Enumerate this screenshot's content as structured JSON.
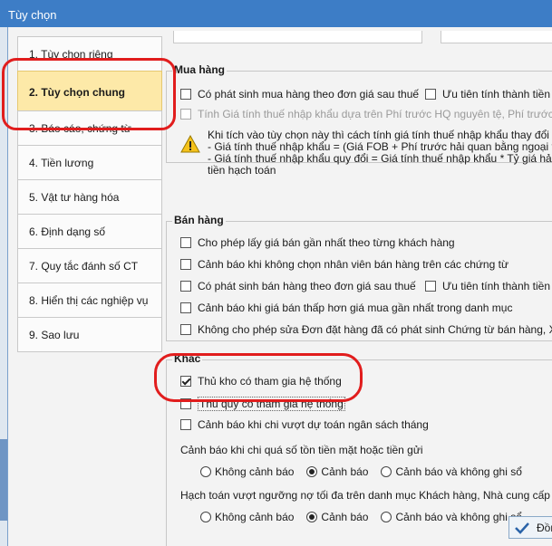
{
  "window": {
    "title": "Tùy chọn"
  },
  "nav": {
    "items": [
      {
        "label": "1. Tùy chọn riêng",
        "active": false
      },
      {
        "label": "2. Tùy chọn chung",
        "active": true
      },
      {
        "label": "3. Báo cáo, chứng từ",
        "active": false
      },
      {
        "label": "4. Tiền lương",
        "active": false
      },
      {
        "label": "5. Vật tư hàng hóa",
        "active": false
      },
      {
        "label": "6. Định dạng số",
        "active": false
      },
      {
        "label": "7. Quy tắc đánh số CT",
        "active": false
      },
      {
        "label": "8. Hiển thị các nghiệp vụ",
        "active": false
      },
      {
        "label": "9. Sao lưu",
        "active": false
      }
    ]
  },
  "mua_hang": {
    "title": "Mua hàng",
    "opt1": "Có phát sinh mua hàng theo đơn giá sau thuế",
    "opt2": "Ưu tiên tính thành tiền the",
    "opt3": "Tính Giá tính thuế nhập khẩu dựa trên Phí trước HQ nguyên tệ, Phí trước HQ bằn",
    "note1": "Khi tích vào tùy chọn này thì cách tính giá tính thuế nhập khẩu thay đổi như sa",
    "note2": "- Giá tính thuế nhập khẩu = (Giá FOB + Phí trước hải quan bằng ngoại tệ)",
    "note3": "- Giá tính thuế nhập khẩu quy đổi = Giá tính thuế nhập khẩu * Tỷ giá hải quan",
    "note4": "tiền hạch toán"
  },
  "ban_hang": {
    "title": "Bán hàng",
    "opt1": "Cho phép lấy giá bán gần nhất theo từng khách hàng",
    "opt2": "Cảnh báo khi không chọn nhân viên bán hàng trên các chứng từ",
    "opt3": "Có phát sinh bán hàng theo đơn giá sau thuế",
    "opt4": "Ưu tiên tính thành tiền the",
    "opt5": "Cảnh báo khi giá bán thấp hơn giá mua gần nhất trong danh mục",
    "opt6": "Không cho phép sửa Đơn đặt hàng đã có phát sinh Chứng từ bán hàng, Xuất kho"
  },
  "khac": {
    "title": "Khác",
    "opt1": "Thủ kho có tham gia hệ thống",
    "opt2": "Thủ quỹ có tham gia hệ thống",
    "opt3": "Cảnh báo khi chi vượt dự toán ngân sách tháng",
    "q1": "Cảnh báo khi chi quá số tồn tiền mặt hoặc tiền gửi",
    "q2": "Hạch toán vượt ngưỡng nợ tối đa trên danh mục Khách hàng, Nhà cung cấp",
    "r_none": "Không cảnh báo",
    "r_warn": "Cảnh báo",
    "r_warn_nosave": "Cảnh báo và không ghi sổ"
  },
  "footer": {
    "ok": "Đồng"
  },
  "colors": {
    "highlight_ring": "#e11d1d",
    "active_tab": "#fde9a8",
    "titlebar": "#3d7dc6"
  }
}
